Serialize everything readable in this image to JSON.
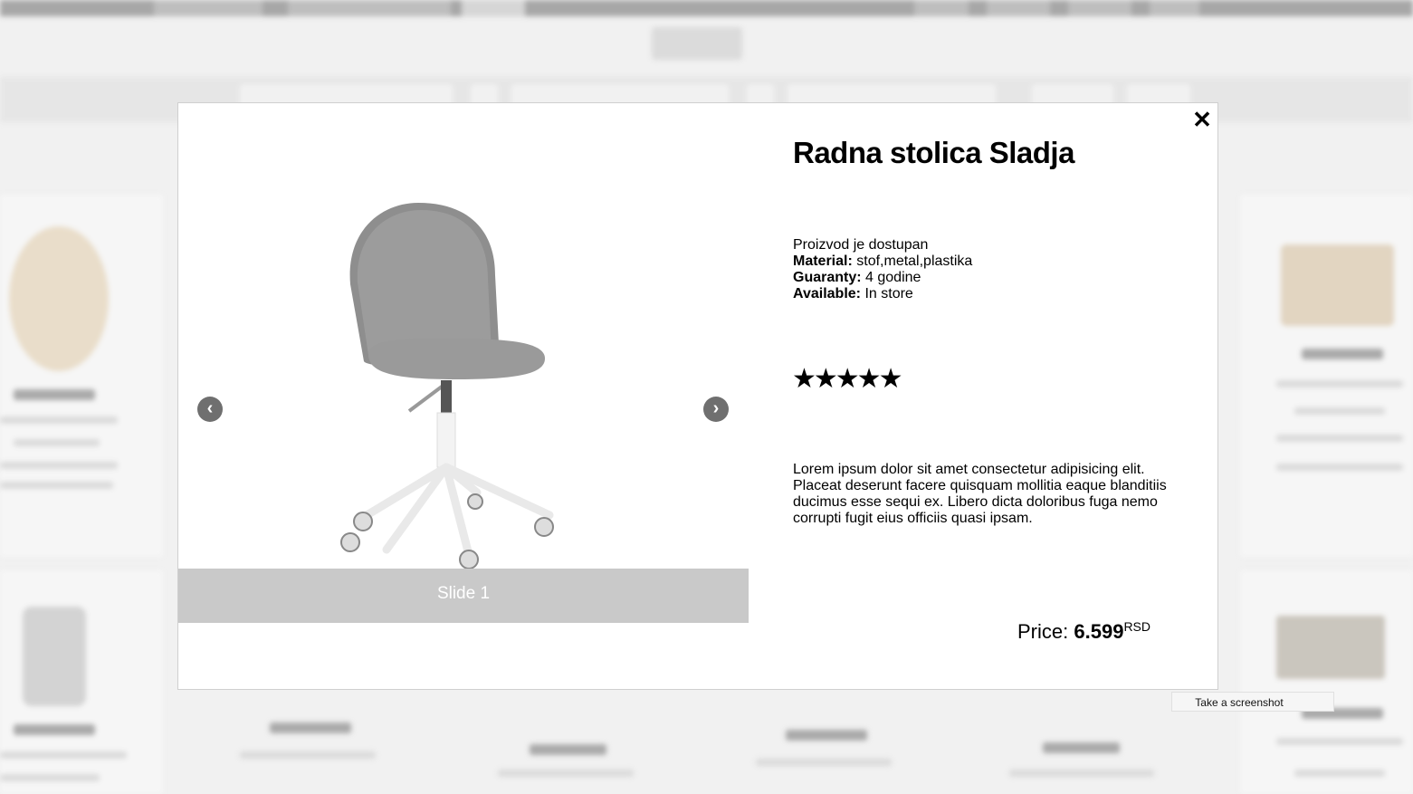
{
  "product": {
    "title": "Radna stolica Sladja",
    "availability": "Proizvod je dostupan",
    "material_label": "Material:",
    "material": "stof,metal,plastika",
    "guaranty_label": "Guaranty:",
    "guaranty": "4 godine",
    "available_label": "Available:",
    "available": "In store",
    "rating": 5,
    "stars": "★★★★★",
    "description": "Lorem ipsum dolor sit amet consectetur adipisicing elit. Placeat deserunt facere quisquam mollitia eaque blanditiis ducimus esse sequi ex. Libero dicta doloribus fuga nemo corrupti fugit eius officiis quasi ipsam.",
    "price_label": "Price:",
    "price": "6.599",
    "currency": "RSD"
  },
  "carousel": {
    "caption": "Slide 1",
    "prev_icon": "chevron-left-icon",
    "next_icon": "chevron-right-icon"
  },
  "modal": {
    "close_icon": "close-icon"
  },
  "tooltip": {
    "text": "Take a screenshot"
  },
  "colors": {
    "caption_bg": "#c9c9c9",
    "nav_arrow": "#6f6f6f",
    "text": "#000000"
  }
}
